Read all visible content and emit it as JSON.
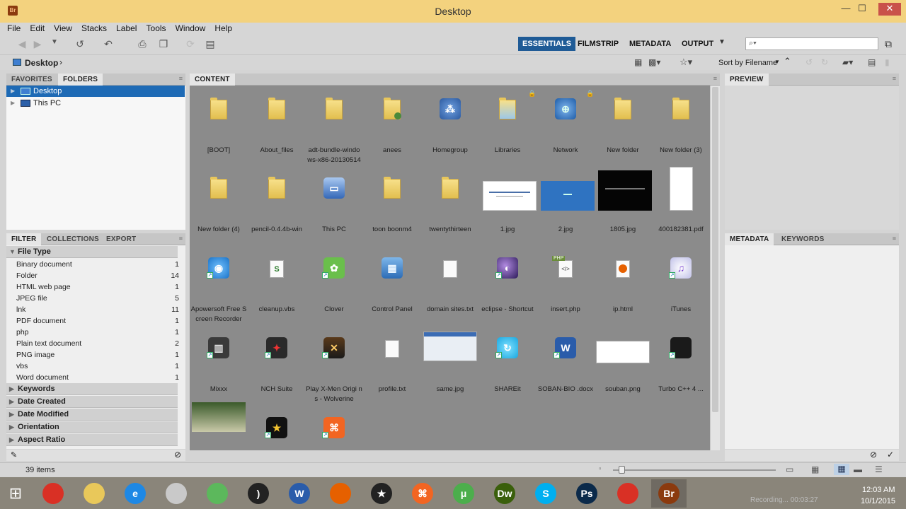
{
  "window": {
    "title": "Desktop",
    "app_badge": "Br"
  },
  "menu": [
    "File",
    "Edit",
    "View",
    "Stacks",
    "Label",
    "Tools",
    "Window",
    "Help"
  ],
  "workspaces": [
    {
      "label": "ESSENTIALS",
      "active": true
    },
    {
      "label": "FILMSTRIP",
      "active": false
    },
    {
      "label": "METADATA",
      "active": false
    },
    {
      "label": "OUTPUT",
      "active": false
    }
  ],
  "search": {
    "placeholder": ""
  },
  "sort": {
    "label": "Sort by Filename"
  },
  "path": {
    "crumb": "Desktop"
  },
  "left_tabs": {
    "favorites": "FAVORITES",
    "folders": "FOLDERS"
  },
  "tree": [
    {
      "label": "Desktop",
      "selected": true
    },
    {
      "label": "This PC",
      "selected": false
    }
  ],
  "filter_tabs": {
    "filter": "FILTER",
    "collections": "COLLECTIONS",
    "export": "EXPORT"
  },
  "filter": {
    "file_type_header": "File Type",
    "file_types": [
      {
        "label": "Binary document",
        "count": "1"
      },
      {
        "label": "Folder",
        "count": "14"
      },
      {
        "label": "HTML web page",
        "count": "1"
      },
      {
        "label": "JPEG file",
        "count": "5"
      },
      {
        "label": "lnk",
        "count": "11"
      },
      {
        "label": "PDF document",
        "count": "1"
      },
      {
        "label": "php",
        "count": "1"
      },
      {
        "label": "Plain text document",
        "count": "2"
      },
      {
        "label": "PNG image",
        "count": "1"
      },
      {
        "label": "vbs",
        "count": "1"
      },
      {
        "label": "Word document",
        "count": "1"
      }
    ],
    "collapsed_headers": [
      "Keywords",
      "Date Created",
      "Date Modified",
      "Orientation",
      "Aspect Ratio"
    ]
  },
  "content_tab": "CONTENT",
  "items": [
    {
      "label": "[BOOT]",
      "kind": "folder"
    },
    {
      "label": "About_files",
      "kind": "folder"
    },
    {
      "label": "adt-bundle-windo ws-x86-20130514",
      "kind": "folder"
    },
    {
      "label": "anees",
      "kind": "user-folder"
    },
    {
      "label": "Homegroup",
      "kind": "homegroup"
    },
    {
      "label": "Libraries",
      "kind": "libraries"
    },
    {
      "label": "Network",
      "kind": "network"
    },
    {
      "label": "New folder",
      "kind": "folder"
    },
    {
      "label": "New folder (3)",
      "kind": "folder"
    },
    {
      "label": "New folder (4)",
      "kind": "folder"
    },
    {
      "label": "pencil-0.4.4b-win",
      "kind": "folder"
    },
    {
      "label": "This PC",
      "kind": "thispc"
    },
    {
      "label": "toon boonm4",
      "kind": "folder"
    },
    {
      "label": "twentythirteen",
      "kind": "folder"
    },
    {
      "label": "1.jpg",
      "kind": "img-white"
    },
    {
      "label": "2.jpg",
      "kind": "img-blue"
    },
    {
      "label": "1805.jpg",
      "kind": "img-black"
    },
    {
      "label": "400182381.pdf",
      "kind": "pdf"
    },
    {
      "label": "Apowersoft Free Screen Recorder",
      "kind": "app-blue"
    },
    {
      "label": "cleanup.vbs",
      "kind": "vbs"
    },
    {
      "label": "Clover",
      "kind": "app-green"
    },
    {
      "label": "Control Panel",
      "kind": "controlpanel"
    },
    {
      "label": "domain sites.txt",
      "kind": "txt"
    },
    {
      "label": "eclipse - Shortcut",
      "kind": "eclipse"
    },
    {
      "label": "insert.php",
      "kind": "php"
    },
    {
      "label": "ip.html",
      "kind": "html"
    },
    {
      "label": "iTunes",
      "kind": "itunes"
    },
    {
      "label": "Mixxx",
      "kind": "app-dark"
    },
    {
      "label": "NCH Suite",
      "kind": "app-red"
    },
    {
      "label": "Play X-Men Origi ns - Wolverine",
      "kind": "app-game"
    },
    {
      "label": "profile.txt",
      "kind": "txt"
    },
    {
      "label": "same.jpg",
      "kind": "img-screen"
    },
    {
      "label": "SHAREit",
      "kind": "app-cyan"
    },
    {
      "label": "SOBAN-BIO .docx",
      "kind": "word"
    },
    {
      "label": "souban.png",
      "kind": "img-sketch"
    },
    {
      "label": "Turbo C++ 4 ...",
      "kind": "app-apple"
    },
    {
      "label": "",
      "kind": "img-web"
    },
    {
      "label": "",
      "kind": "app-star"
    },
    {
      "label": "",
      "kind": "app-xampp"
    }
  ],
  "right_tabs": {
    "preview": "PREVIEW",
    "metadata": "METADATA",
    "keywords": "KEYWORDS"
  },
  "status": {
    "items": "39 items"
  },
  "taskbar": {
    "time": "12:03 AM",
    "date": "10/1/2015",
    "recording": "Recording... 00:03:27",
    "apps": [
      {
        "label": "",
        "icon": "chrome-icon",
        "color": "#d93025"
      },
      {
        "label": "",
        "icon": "explorer-icon",
        "color": "#e9c85a"
      },
      {
        "label": "e",
        "icon": "ie-icon",
        "color": "#1e88e5"
      },
      {
        "label": "",
        "icon": "paint-icon",
        "color": "#c9c9c9"
      },
      {
        "label": "",
        "icon": "clover-icon",
        "color": "#5cb85c"
      },
      {
        "label": ")",
        "icon": "audio-icon",
        "color": "#222"
      },
      {
        "label": "W",
        "icon": "word-icon",
        "color": "#2a5caa"
      },
      {
        "label": "",
        "icon": "firefox-icon",
        "color": "#e66000"
      },
      {
        "label": "★",
        "icon": "movie-icon",
        "color": "#222"
      },
      {
        "label": "⌘",
        "icon": "xampp-icon",
        "color": "#f26522"
      },
      {
        "label": "μ",
        "icon": "utorrent-icon",
        "color": "#4cae4c"
      },
      {
        "label": "Dw",
        "icon": "dreamweaver-icon",
        "color": "#3a5f0b"
      },
      {
        "label": "S",
        "icon": "skype-icon",
        "color": "#00aff0"
      },
      {
        "label": "Ps",
        "icon": "photoshop-icon",
        "color": "#0b2a4a"
      },
      {
        "label": "",
        "icon": "chrome-icon",
        "color": "#d93025"
      },
      {
        "label": "Br",
        "icon": "bridge-icon",
        "color": "#8b3a0e"
      }
    ]
  }
}
